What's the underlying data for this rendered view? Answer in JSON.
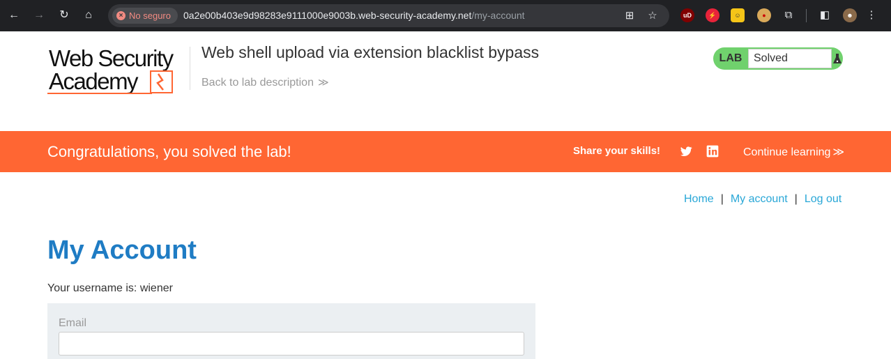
{
  "browser": {
    "security_label": "No seguro",
    "url_host": "0a2e00b403e9d98283e9111000e9003b.web-security-academy.net",
    "url_path": "/my-account",
    "extensions": [
      {
        "name": "ublock",
        "label": "uD",
        "color": "#800000"
      },
      {
        "name": "lightning",
        "label": "⚡",
        "color": "#e8233a"
      },
      {
        "name": "lego",
        "label": "☺",
        "color": "#f5c518"
      },
      {
        "name": "cookie",
        "label": "●",
        "color": "#d9a95a"
      }
    ]
  },
  "header": {
    "logo_line1": "Web Security",
    "logo_line2": "Academy",
    "lab_title": "Web shell upload via extension blacklist bypass",
    "back_link": "Back to lab description",
    "back_chevron": "≫",
    "lab_badge": "LAB",
    "lab_state": "Solved",
    "status_color": "#70d16d"
  },
  "banner": {
    "message": "Congratulations, you solved the lab!",
    "share_label": "Share your skills!",
    "continue_label": "Continue learning",
    "continue_chevron": "≫",
    "color": "#ff6633"
  },
  "nav": {
    "home": "Home",
    "my_account": "My account",
    "log_out": "Log out",
    "separator": "|"
  },
  "main": {
    "heading": "My Account",
    "username_line": "Your username is: wiener",
    "email_label": "Email",
    "email_value": ""
  }
}
